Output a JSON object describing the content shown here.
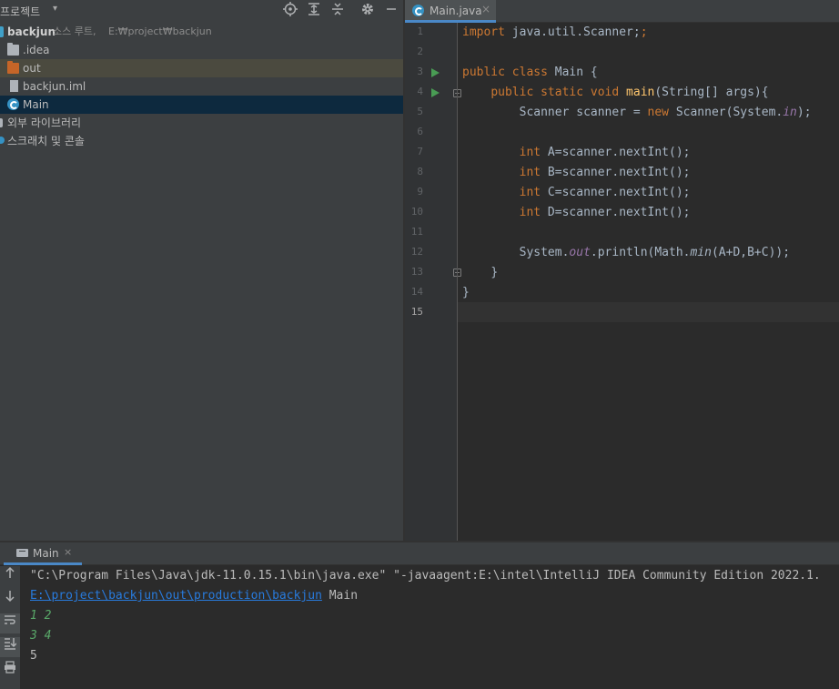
{
  "project_panel": {
    "title": "프로젝트",
    "caret": "▾",
    "toolbar_icons": [
      "locate-icon",
      "expand-all-icon",
      "collapse-all-icon",
      "gear-icon",
      "minimize-icon"
    ],
    "tree": [
      {
        "name": "backjun",
        "suffix": "소스 루트,",
        "path": "E:₩project₩backjun",
        "icon": "module-icon"
      },
      {
        "name": ".idea",
        "icon": "folder-icon"
      },
      {
        "name": "out",
        "icon": "folder-orange-icon"
      },
      {
        "name": "backjun.iml",
        "icon": "iml-file-icon"
      },
      {
        "name": "Main",
        "icon": "java-class-icon"
      },
      {
        "name": "외부 라이브러리",
        "icon": "library-icon"
      },
      {
        "name": "스크래치 및 콘솔",
        "icon": "scratch-icon"
      }
    ]
  },
  "editor": {
    "tab": {
      "label": "Main.java",
      "close": "×"
    },
    "line_numbers": [
      "1",
      "2",
      "3",
      "4",
      "5",
      "6",
      "7",
      "8",
      "9",
      "10",
      "11",
      "12",
      "13",
      "14",
      "15"
    ],
    "current_line": "15",
    "code": {
      "l1_kw": "import",
      "l1_rest": " java.util.Scanner;",
      "l3_kw1": "public",
      "l3_kw2": "class",
      "l3_rest": " Main {",
      "l4_kw1": "public",
      "l4_kw2": "static",
      "l4_kw3": "void",
      "l4_fn": "main",
      "l4_rest": "(String[] args){",
      "l5_a": "Scanner scanner = ",
      "l5_kw": "new",
      "l5_b": " Scanner(System.",
      "l5_sf": "in",
      "l5_c": ");",
      "l7_kw": "int",
      "l7_rest": " A=scanner.nextInt();",
      "l8_kw": "int",
      "l8_rest": " B=scanner.nextInt();",
      "l9_kw": "int",
      "l9_rest": " C=scanner.nextInt();",
      "l10_kw": "int",
      "l10_rest": " D=scanner.nextInt();",
      "l12_a": "System.",
      "l12_sf": "out",
      "l12_b": ".println(Math.",
      "l12_st": "min",
      "l12_c": "(A+D,B+C));",
      "l13": "}",
      "l14": "}"
    }
  },
  "run_panel": {
    "tab": {
      "label": "Main",
      "close": "×"
    },
    "toolbar_icons": [
      "up-arrow-icon",
      "down-arrow-icon",
      "soft-wrap-icon",
      "scroll-to-end-icon",
      "print-icon"
    ],
    "console": {
      "command": "\"C:\\Program Files\\Java\\jdk-11.0.15.1\\bin\\java.exe\" \"-javaagent:E:\\intel\\IntelliJ IDEA Community Edition 2022.1.",
      "classpath_link": "E:\\project\\backjun\\out\\production\\backjun",
      "main_class": " Main",
      "input1": "1 2",
      "input2": "3 4",
      "output": "5"
    }
  }
}
